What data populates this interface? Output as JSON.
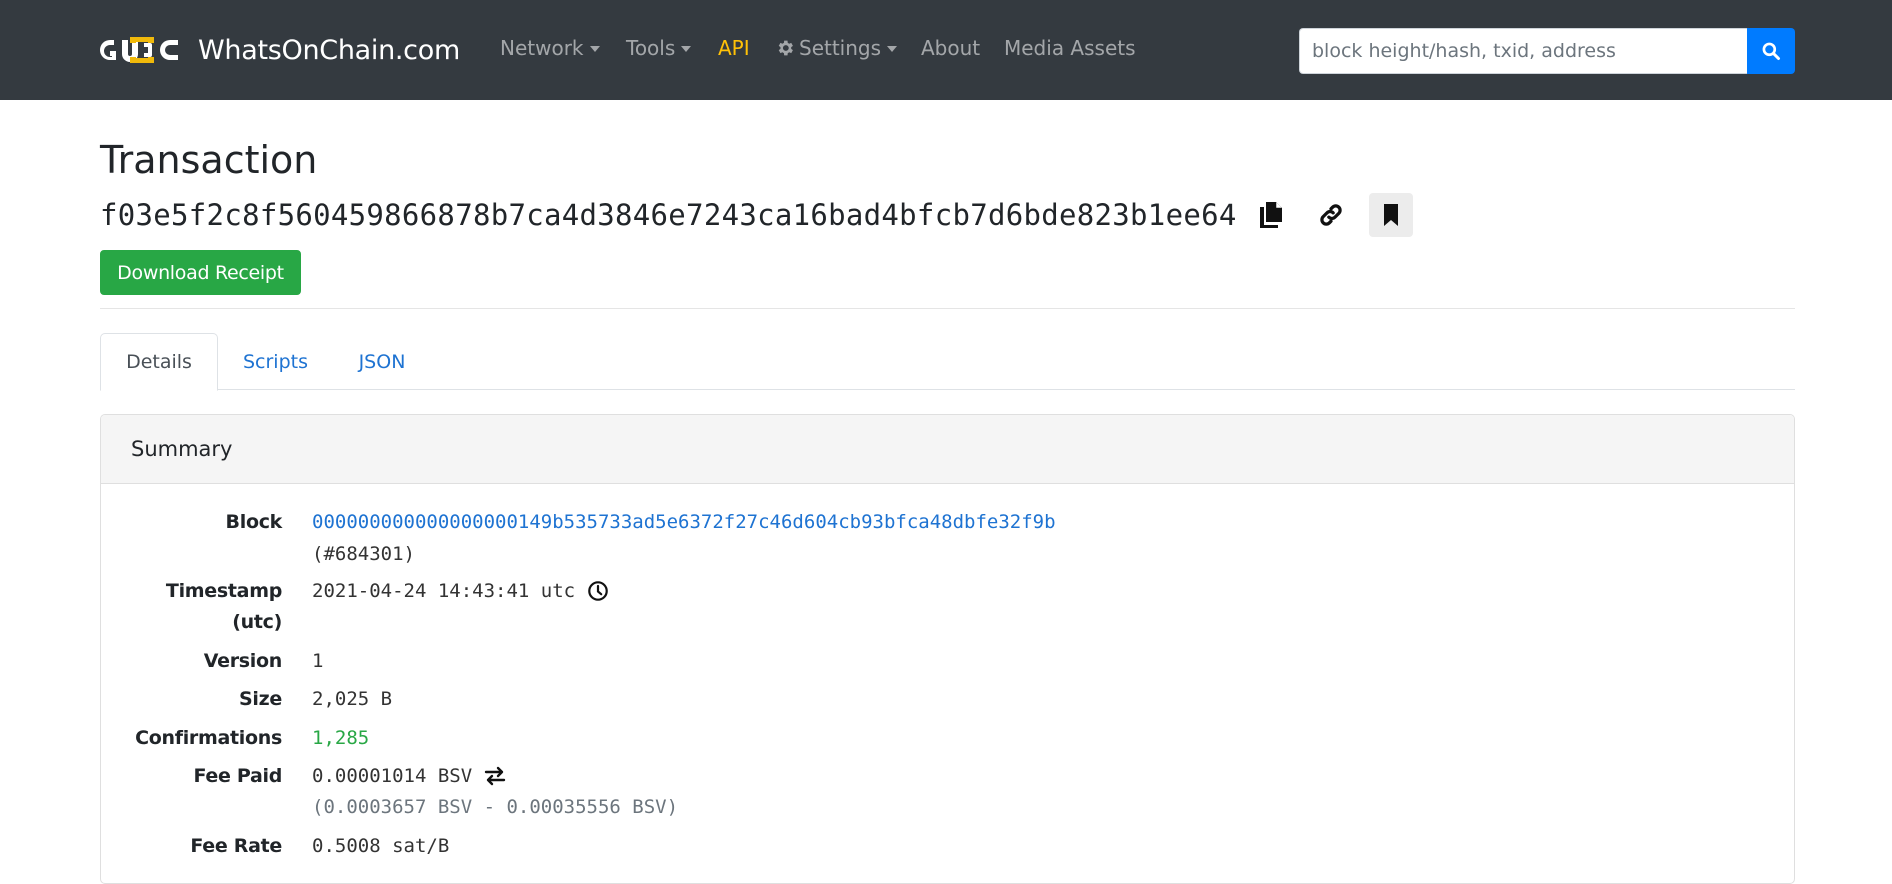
{
  "navbar": {
    "brand": "WhatsOnChain.com",
    "items": [
      {
        "label": "Network",
        "dropdown": true
      },
      {
        "label": "Tools",
        "dropdown": true
      },
      {
        "label": "API",
        "dropdown": false,
        "highlight": "#ffc107"
      },
      {
        "label": "Settings",
        "dropdown": true,
        "icon": "gear-icon"
      },
      {
        "label": "About",
        "dropdown": false
      },
      {
        "label": "Media Assets",
        "dropdown": false
      }
    ],
    "search": {
      "placeholder": "block height/hash, txid, address",
      "value": "",
      "button_icon": "search-icon"
    }
  },
  "header": {
    "title": "Transaction",
    "txid": "f03e5f2c8f560459866878b7ca4d3846e7243ca16bad4bfcb7d6bde823b1ee64",
    "actions": [
      "copy-icon",
      "link-icon",
      "bookmark-icon"
    ],
    "download_receipt_label": "Download Receipt"
  },
  "tabs": [
    {
      "label": "Details",
      "active": true
    },
    {
      "label": "Scripts",
      "active": false
    },
    {
      "label": "JSON",
      "active": false
    }
  ],
  "summary": {
    "title": "Summary",
    "block": {
      "label": "Block",
      "hash": "000000000000000000149b535733ad5e6372f27c46d604cb93bfca48dbfe32f9b",
      "height": "(#684301)"
    },
    "timestamp": {
      "label_line1": "Timestamp",
      "label_line2": "(utc)",
      "value": "2021-04-24 14:43:41 utc"
    },
    "version": {
      "label": "Version",
      "value": "1"
    },
    "size": {
      "label": "Size",
      "value": "2,025 B"
    },
    "confirmations": {
      "label": "Confirmations",
      "value": "1,285"
    },
    "fee_paid": {
      "label": "Fee Paid",
      "value": "0.00001014 BSV",
      "breakdown": "(0.0003657 BSV - 0.00035556 BSV)"
    },
    "fee_rate": {
      "label": "Fee Rate",
      "value": "0.5008 sat/B"
    }
  },
  "colors": {
    "navbar_bg": "#343a40",
    "accent_blue": "#007bff",
    "link_blue": "#1e73d2",
    "success_green": "#28a745",
    "api_yellow": "#ffc107"
  }
}
